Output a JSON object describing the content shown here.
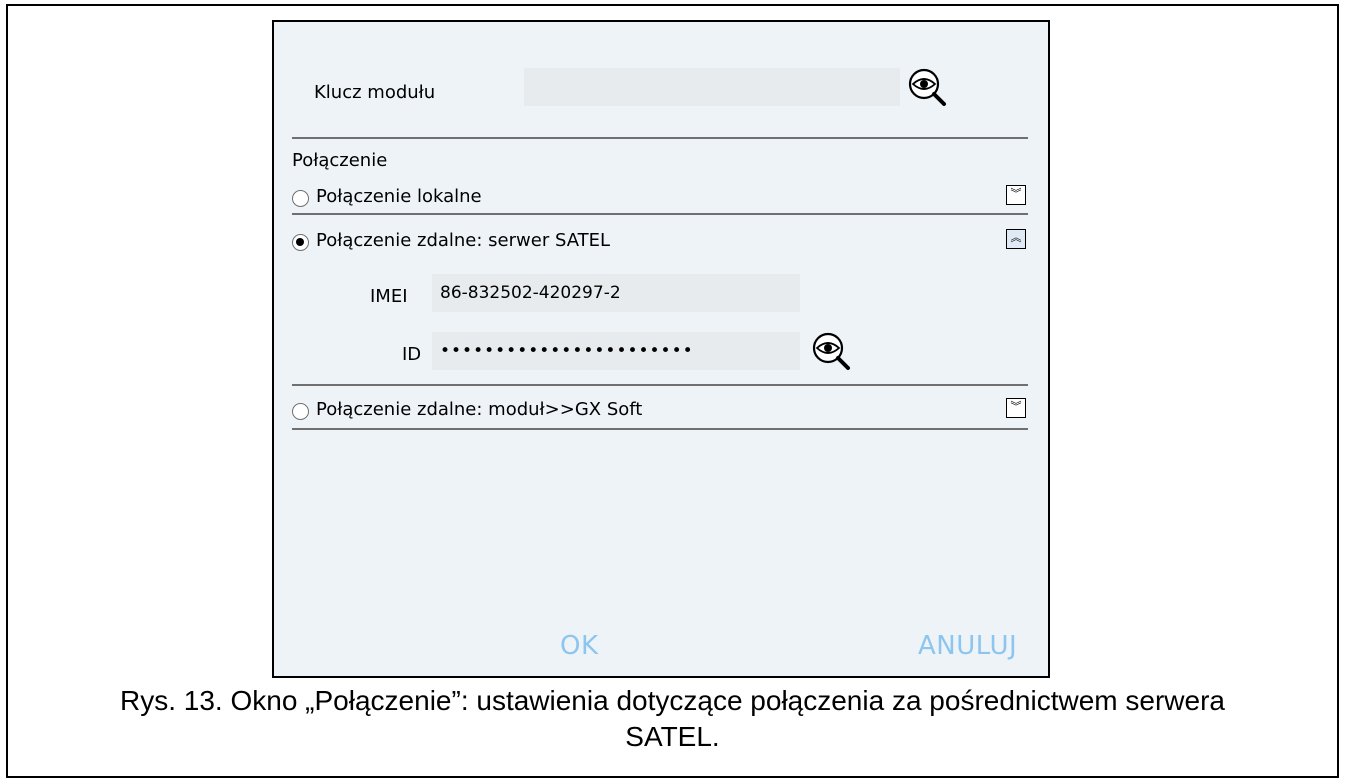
{
  "dialog": {
    "module_key_label": "Klucz modułu",
    "module_key_value": "",
    "connection_label": "Połączenie",
    "options": [
      {
        "label": "Połączenie lokalne",
        "selected": false,
        "expanded": false
      },
      {
        "label": "Połączenie zdalne: serwer SATEL",
        "selected": true,
        "expanded": true
      },
      {
        "label": "Połączenie zdalne: moduł>>GX Soft",
        "selected": false,
        "expanded": false
      }
    ],
    "imei_label": "IMEI",
    "imei_value": "86-832502-420297-2",
    "id_label": "ID",
    "id_value": "•••••••••••••••••••••••",
    "ok_label": "OK",
    "cancel_label": "ANULUJ",
    "icons": {
      "show_key": "eye-magnifier-icon",
      "show_id": "eye-magnifier-icon",
      "expand": "double-chevron-down-icon",
      "collapse": "double-chevron-up-icon"
    },
    "colors": {
      "dialog_bg": "#eef3f7",
      "field_bg": "#e7ebee",
      "button_text": "#8cc6ef"
    }
  },
  "caption": {
    "line1": "Rys. 13. Okno „Połączenie”: ustawienia dotyczące połączenia za pośrednictwem serwera",
    "line2": "SATEL."
  }
}
